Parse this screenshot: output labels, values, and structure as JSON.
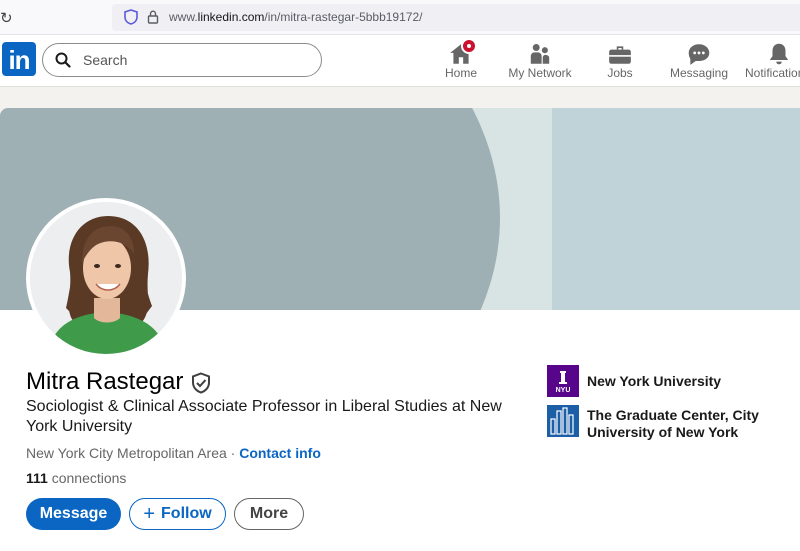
{
  "browser": {
    "url_prefix": "www.",
    "url_domain": "linkedin.com",
    "url_path": "/in/mitra-rastegar-5bbb19172/"
  },
  "nav": {
    "search_placeholder": "Search",
    "items": [
      {
        "label": "Home",
        "icon": "home-icon"
      },
      {
        "label": "My Network",
        "icon": "network-icon"
      },
      {
        "label": "Jobs",
        "icon": "briefcase-icon"
      },
      {
        "label": "Messaging",
        "icon": "chat-icon"
      },
      {
        "label": "Notifications",
        "icon": "bell-icon"
      }
    ],
    "logo_text": "in"
  },
  "profile": {
    "name": "Mitra Rastegar",
    "headline": "Sociologist & Clinical Associate Professor in Liberal Studies at New York University",
    "location": "New York City Metropolitan Area",
    "location_sep": " · ",
    "contact_info": "Contact info",
    "connections_count": "111",
    "connections_label": " connections",
    "buttons": {
      "message": "Message",
      "follow": "Follow",
      "more": "More"
    },
    "organizations": [
      {
        "name": "New York University",
        "logo": "nyu-logo",
        "logo_text": "NYU"
      },
      {
        "name": "The Graduate Center, City University of New York",
        "logo": "cuny-gc-logo"
      }
    ]
  },
  "colors": {
    "brand": "#0a66c2",
    "nyu_purple": "#57068c",
    "cuny_blue": "#1d5fa6",
    "badge": "#cb112d"
  }
}
